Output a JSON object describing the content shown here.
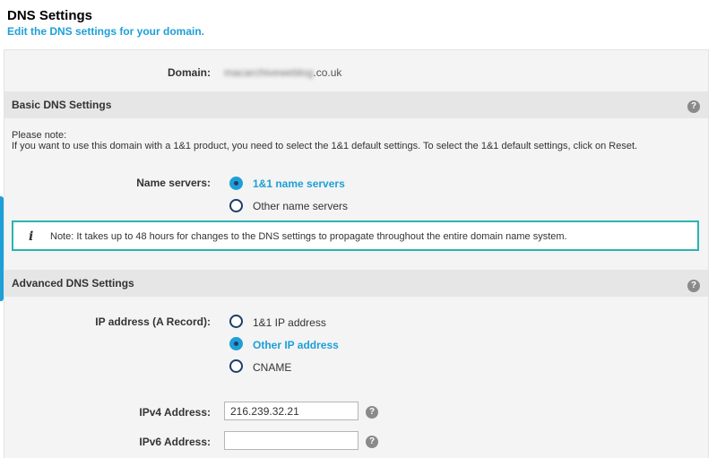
{
  "header": {
    "title": "DNS Settings",
    "subtitle": "Edit the DNS settings for your domain."
  },
  "domain": {
    "label": "Domain:",
    "value_hidden": "macarchiveweblog",
    "value_suffix": ".co.uk"
  },
  "basic": {
    "title": "Basic DNS Settings",
    "note_line1": "Please note:",
    "note_line2": "If you want to use this domain with a 1&1 product, you need to select the 1&1 default settings. To select the 1&1 default settings, click on Reset.",
    "name_servers_label": "Name servers:",
    "options": [
      {
        "label": "1&1 name servers",
        "checked": true
      },
      {
        "label": "Other name servers",
        "checked": false
      }
    ],
    "info": "Note: It takes up to 48 hours for changes to the DNS settings to propagate throughout the entire domain name system."
  },
  "advanced": {
    "title": "Advanced DNS Settings",
    "ip_label": "IP address (A Record):",
    "options": [
      {
        "label": "1&1 IP address",
        "checked": false
      },
      {
        "label": "Other IP address",
        "checked": true
      },
      {
        "label": "CNAME",
        "checked": false
      }
    ],
    "ipv4_label": "IPv4 Address:",
    "ipv4_value": "216.239.32.21",
    "ipv6_label": "IPv6 Address:",
    "ipv6_value": ""
  },
  "icons": {
    "help": "?",
    "info": "i"
  },
  "colors": {
    "accent": "#1d9fd8",
    "info_border": "#2bb3b0",
    "radio_border": "#1f3d66"
  }
}
